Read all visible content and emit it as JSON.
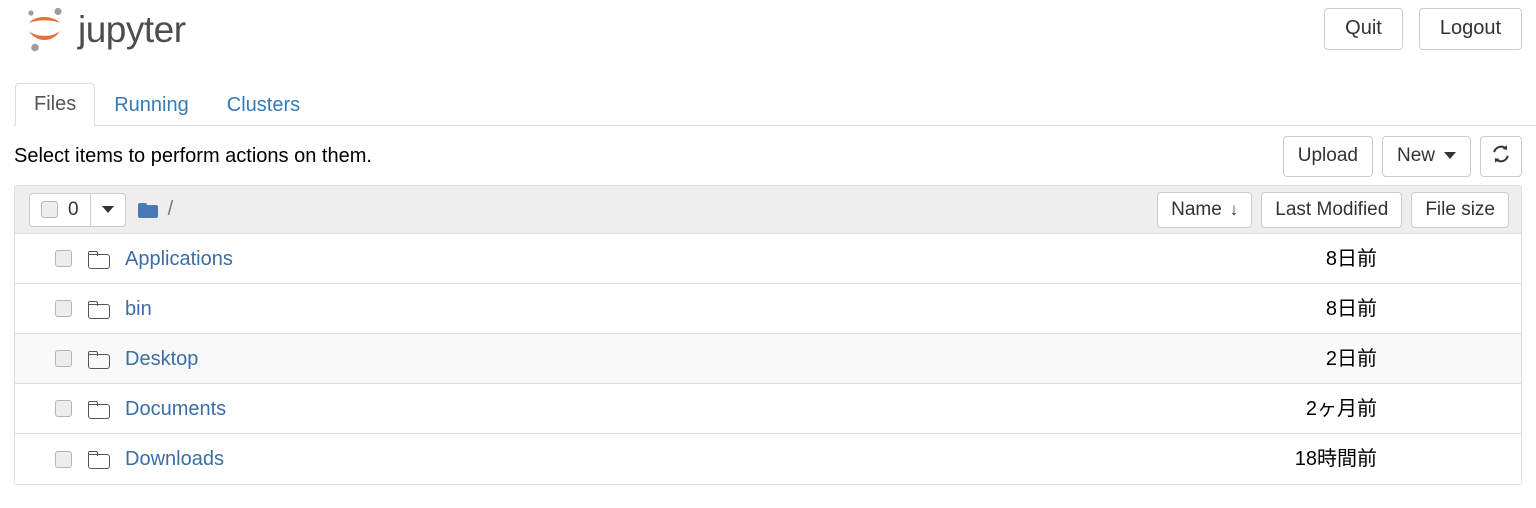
{
  "header": {
    "brand_name": "jupyter",
    "logo_icon": "jupyter-logo-icon",
    "quit_label": "Quit",
    "logout_label": "Logout"
  },
  "tabs": [
    {
      "label": "Files",
      "active": true
    },
    {
      "label": "Running",
      "active": false
    },
    {
      "label": "Clusters",
      "active": false
    }
  ],
  "action_row": {
    "hint": "Select items to perform actions on them.",
    "upload_label": "Upload",
    "new_label": "New",
    "new_caret_icon": "chevron-down-icon",
    "refresh_icon": "refresh-icon"
  },
  "list_header": {
    "selected_count": "0",
    "select_caret_icon": "chevron-down-icon",
    "breadcrumb_folder_icon": "folder-icon",
    "breadcrumb_path": "/",
    "sort_name_label": "Name",
    "sort_name_arrow": "↓",
    "sort_modified_label": "Last Modified",
    "sort_size_label": "File size"
  },
  "rows": [
    {
      "icon": "folder-icon",
      "name": "Applications",
      "modified": "8日前",
      "size": "",
      "hover": false
    },
    {
      "icon": "folder-icon",
      "name": "bin",
      "modified": "8日前",
      "size": "",
      "hover": false
    },
    {
      "icon": "folder-icon",
      "name": "Desktop",
      "modified": "2日前",
      "size": "",
      "hover": true
    },
    {
      "icon": "folder-icon",
      "name": "Documents",
      "modified": "2ヶ月前",
      "size": "",
      "hover": false
    },
    {
      "icon": "folder-icon",
      "name": "Downloads",
      "modified": "18時間前",
      "size": "",
      "hover": false
    }
  ],
  "colors": {
    "brand_orange": "#e8713a",
    "link_blue": "#3a6ea5",
    "tab_blue": "#337ab7",
    "folder_blue": "#4a7ab5",
    "border_gray": "#dddddd",
    "header_gray": "#eeeeee"
  }
}
